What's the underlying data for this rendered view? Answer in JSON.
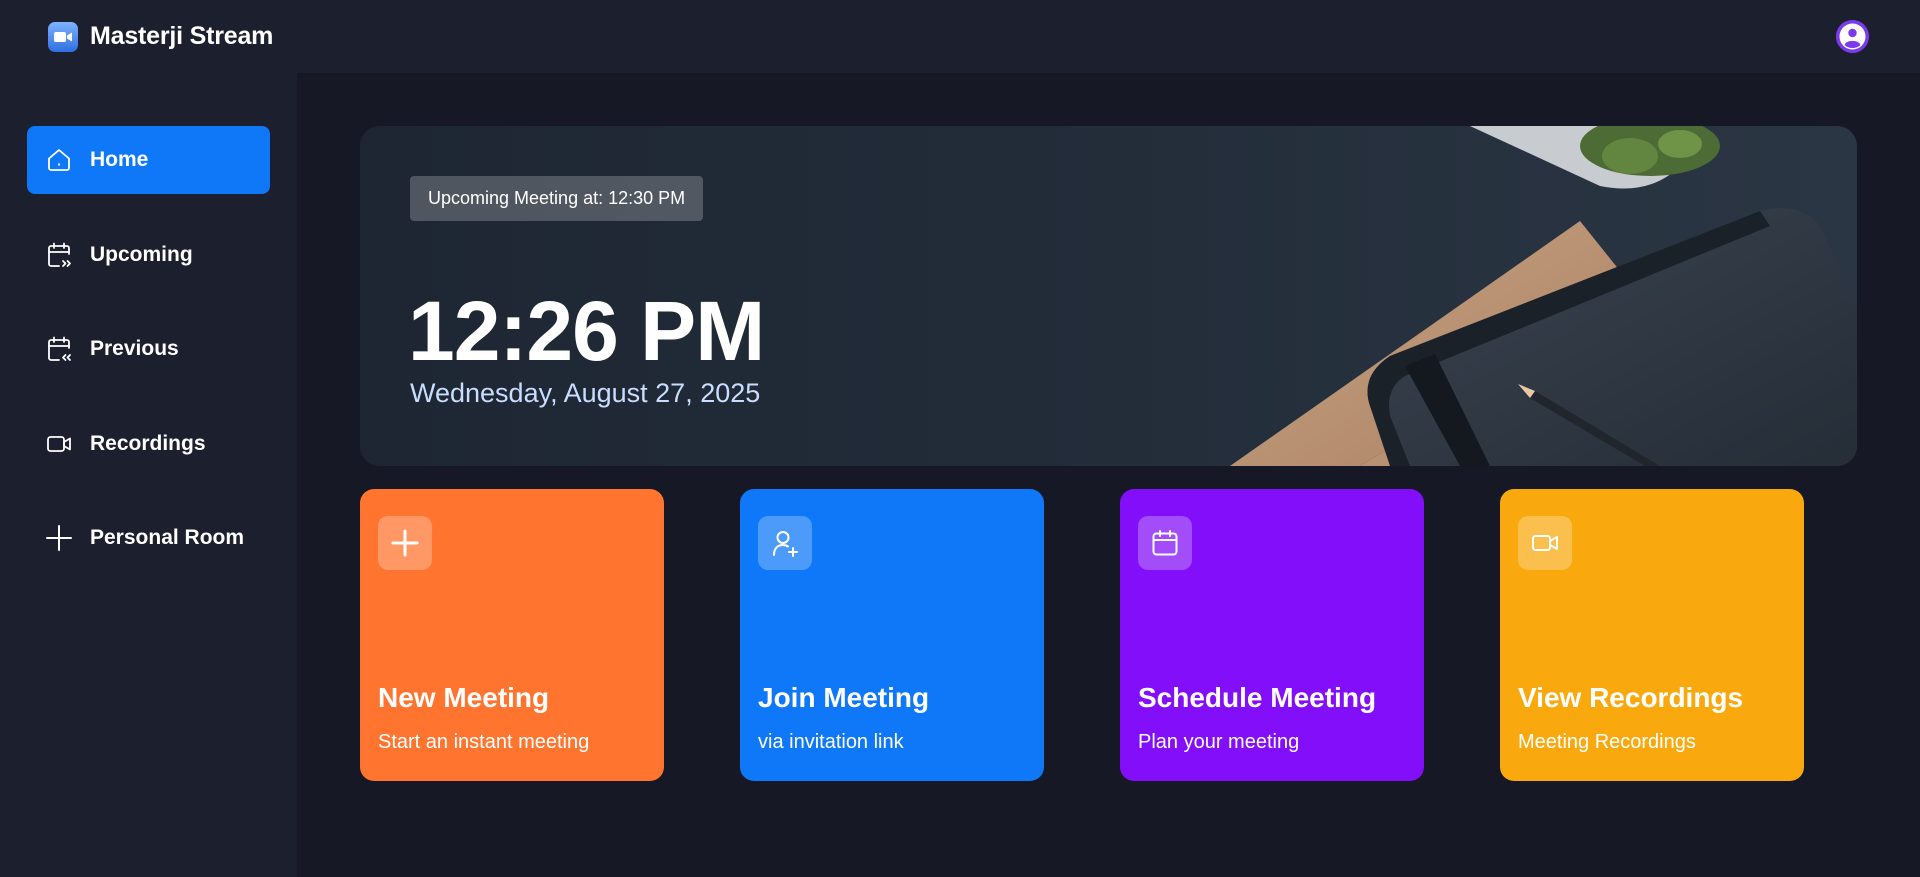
{
  "app": {
    "name": "Masterji Stream",
    "logo_icon": "video-camera-icon",
    "avatar_icon": "user-avatar-icon"
  },
  "colors": {
    "background": "#1c1f2e",
    "main_background": "#161925",
    "active_nav": "#0e78f9",
    "date_text": "#c9ddff"
  },
  "sidebar": {
    "items": [
      {
        "label": "Home",
        "icon": "home-icon",
        "active": true
      },
      {
        "label": "Upcoming",
        "icon": "calendar-upcoming-icon",
        "active": false
      },
      {
        "label": "Previous",
        "icon": "calendar-previous-icon",
        "active": false
      },
      {
        "label": "Recordings",
        "icon": "video-icon",
        "active": false
      },
      {
        "label": "Personal Room",
        "icon": "plus-icon",
        "active": false
      }
    ]
  },
  "hero": {
    "badge": "Upcoming Meeting at: 12:30 PM",
    "time": "12:26 PM",
    "date": "Wednesday, August 27, 2025"
  },
  "cards": [
    {
      "title": "New Meeting",
      "subtitle": "Start an instant meeting",
      "icon": "plus-icon",
      "color": "#ff742e"
    },
    {
      "title": "Join Meeting",
      "subtitle": "via invitation link",
      "icon": "user-add-icon",
      "color": "#0e78f9"
    },
    {
      "title": "Schedule Meeting",
      "subtitle": "Plan your meeting",
      "icon": "calendar-icon",
      "color": "#830ef9"
    },
    {
      "title": "View Recordings",
      "subtitle": "Meeting Recordings",
      "icon": "video-icon",
      "color": "#f9a90e"
    }
  ]
}
